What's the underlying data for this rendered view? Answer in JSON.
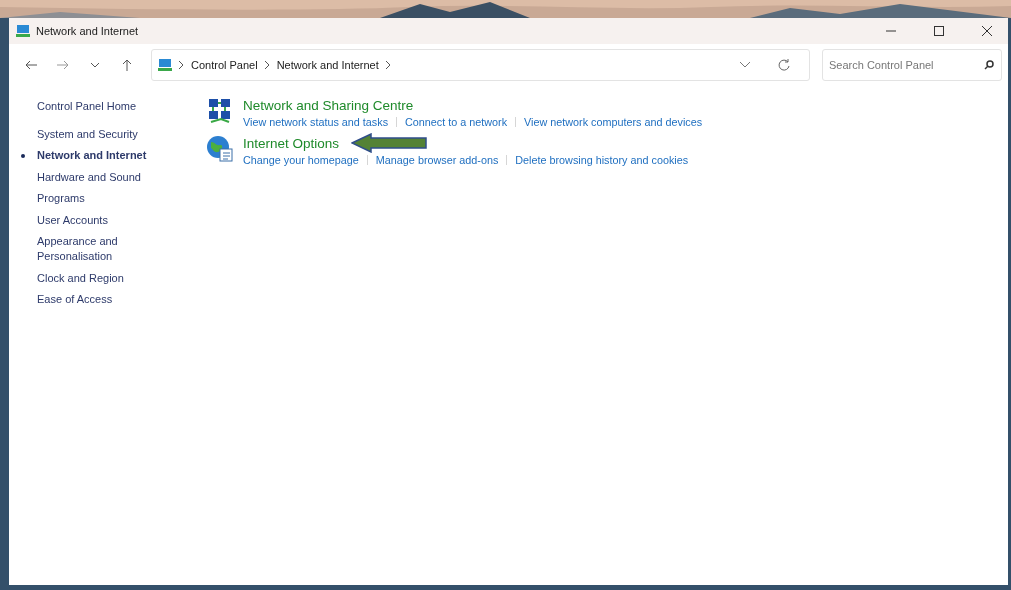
{
  "window": {
    "title": "Network and Internet"
  },
  "address_bar": {
    "breadcrumbs": [
      "Control Panel",
      "Network and Internet"
    ]
  },
  "search": {
    "placeholder": "Search Control Panel"
  },
  "sidebar": {
    "home": "Control Panel Home",
    "items": [
      {
        "label": "System and Security",
        "selected": false
      },
      {
        "label": "Network and Internet",
        "selected": true
      },
      {
        "label": "Hardware and Sound",
        "selected": false
      },
      {
        "label": "Programs",
        "selected": false
      },
      {
        "label": "User Accounts",
        "selected": false
      },
      {
        "label": "Appearance and Personalisation",
        "selected": false
      },
      {
        "label": "Clock and Region",
        "selected": false
      },
      {
        "label": "Ease of Access",
        "selected": false
      }
    ]
  },
  "categories": [
    {
      "title": "Network and Sharing Centre",
      "kind": "network",
      "pointed_at": false,
      "links": [
        "View network status and tasks",
        "Connect to a network",
        "View network computers and devices"
      ]
    },
    {
      "title": "Internet Options",
      "kind": "globe",
      "pointed_at": true,
      "links": [
        "Change your homepage",
        "Manage browser add-ons",
        "Delete browsing history and cookies"
      ]
    }
  ]
}
